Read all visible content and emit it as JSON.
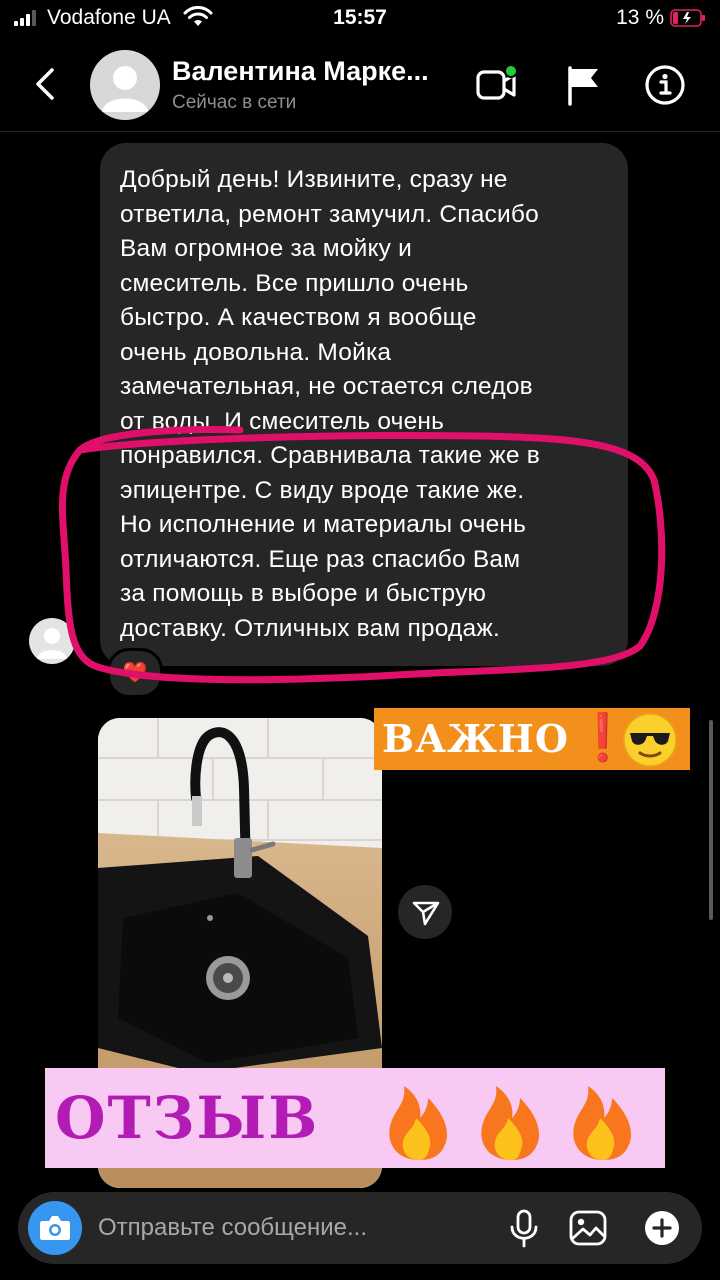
{
  "status_bar": {
    "carrier": "Vodafone UA",
    "time": "15:57",
    "battery": "13 %"
  },
  "header": {
    "contact_name": "Валентина Марке...",
    "contact_status": "Сейчас в сети",
    "icons": [
      "back-icon",
      "video-call-icon",
      "flag-icon",
      "info-icon"
    ]
  },
  "message": {
    "lines": [
      "Добрый день! Извините, сразу не",
      "ответила, ремонт замучил. Спасибо",
      "Вам огромное за мойку и",
      "смеситель. Все пришло очень",
      "быстро. А качеством я вообще",
      "очень довольна. Мойка",
      "замечательная, не остается следов",
      "от воды. И смеситель очень",
      "понравился. Сравнивала такие же в",
      "эпицентре. С виду вроде такие же.",
      "Но исполнение и материалы очень",
      "отличаются. Еще раз спасибо Вам",
      "за помощь в выборе и быструю",
      "доставку. Отличных вам продаж."
    ],
    "reaction": "❤️"
  },
  "stickers": {
    "important_label": "ВАЖНО",
    "important_mark": "❗",
    "important_emoji": "😎",
    "review_label": "ОТЗЫВ",
    "review_emoji": "🔥🔥🔥"
  },
  "composer": {
    "placeholder": "Отправьте сообщение...",
    "icons": [
      "camera-icon",
      "microphone-icon",
      "gallery-icon",
      "plus-icon"
    ]
  },
  "colors": {
    "bubble": "#262626",
    "highlight_circle": "#e0106a",
    "important_bg": "#f3901c",
    "review_bg": "#f7c9f3",
    "review_text": "#b21bb4",
    "online_dot": "#27c93f",
    "camera_button": "#3797f0"
  }
}
